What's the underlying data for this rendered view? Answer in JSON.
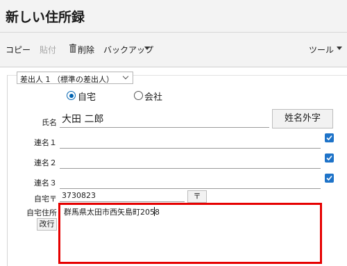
{
  "window": {
    "title": "新しい住所録"
  },
  "toolbar": {
    "copy": "コピー",
    "paste": "貼付",
    "delete": "削除",
    "backup": "バックアップ",
    "tools": "ツール"
  },
  "sender": {
    "selected": "差出人 1 （標準の差出人）"
  },
  "location": {
    "home_label": "自宅",
    "company_label": "会社",
    "selected": "自宅"
  },
  "name": {
    "label": "氏名",
    "value": "大田 二郎",
    "gaiji_button": "姓名外字"
  },
  "joint_names": [
    {
      "label": "連名１",
      "value": "",
      "checked": true
    },
    {
      "label": "連名２",
      "value": "",
      "checked": true
    },
    {
      "label": "連名３",
      "value": "",
      "checked": true
    }
  ],
  "postal": {
    "label": "自宅〒",
    "value": "3730823",
    "button": "〒"
  },
  "address": {
    "label": "自宅住所",
    "newline_button": "改行",
    "value": "群馬県太田市西矢島町2058"
  }
}
